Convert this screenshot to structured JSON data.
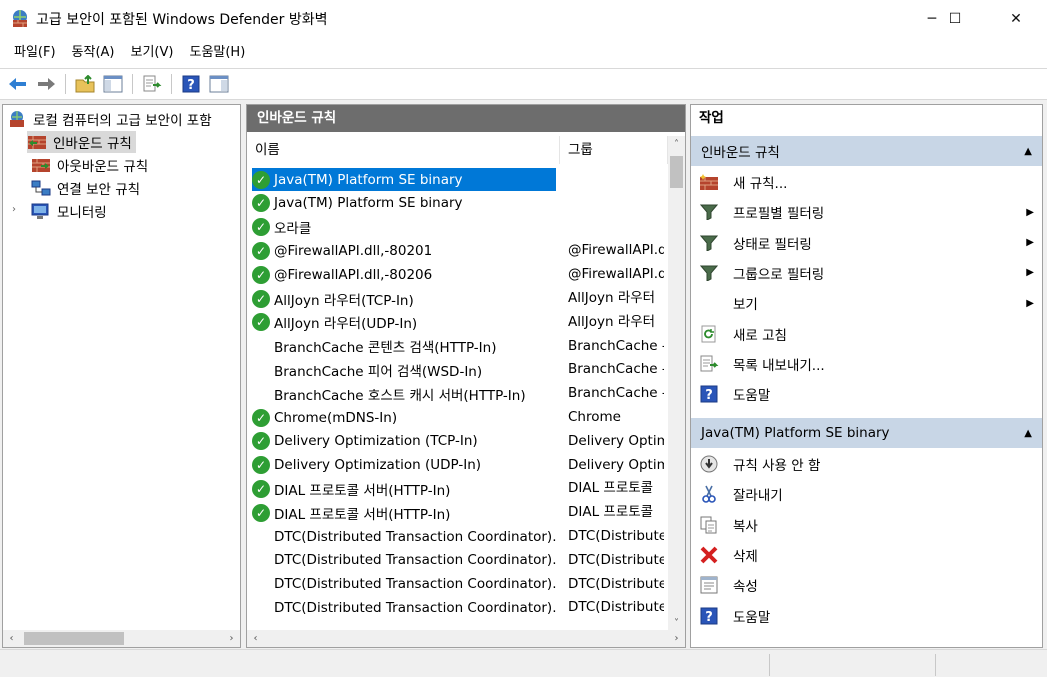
{
  "window": {
    "title": "고급 보안이 포함된 Windows Defender 방화벽",
    "minimize": "─",
    "maximize": "☐",
    "close": "✕"
  },
  "menu": [
    "파일(F)",
    "동작(A)",
    "보기(V)",
    "도움말(H)"
  ],
  "toolbar": {
    "icons": [
      "back-icon",
      "forward-icon",
      "up-folder-icon",
      "show-hide-console-tree-icon",
      "export-icon",
      "help-icon",
      "show-hide-action-pane-icon"
    ]
  },
  "tree": {
    "root": "로컬 컴퓨터의 고급 보안이 포함",
    "items": [
      {
        "label": "인바운드 규칙",
        "selected": true
      },
      {
        "label": "아웃바운드 규칙",
        "selected": false
      },
      {
        "label": "연결 보안 규칙",
        "selected": false
      },
      {
        "label": "모니터링",
        "selected": false
      }
    ]
  },
  "middle": {
    "header": "인바운드 규칙",
    "columns": [
      "이름",
      "그룹"
    ],
    "rows": [
      {
        "name": "Java(TM) Platform SE binary",
        "group": "",
        "enabled": true,
        "selected": true
      },
      {
        "name": "Java(TM) Platform SE binary",
        "group": "",
        "enabled": true,
        "selected": false
      },
      {
        "name": "오라클",
        "group": "",
        "enabled": true,
        "selected": false
      },
      {
        "name": "@FirewallAPI.dll,-80201",
        "group": "@FirewallAPI.d",
        "enabled": true,
        "selected": false
      },
      {
        "name": "@FirewallAPI.dll,-80206",
        "group": "@FirewallAPI.d",
        "enabled": true,
        "selected": false
      },
      {
        "name": "AllJoyn 라우터(TCP-In)",
        "group": "AllJoyn 라우터",
        "enabled": true,
        "selected": false
      },
      {
        "name": "AllJoyn 라우터(UDP-In)",
        "group": "AllJoyn 라우터",
        "enabled": true,
        "selected": false
      },
      {
        "name": "BranchCache 콘텐츠 검색(HTTP-In)",
        "group": "BranchCache -",
        "enabled": false,
        "selected": false
      },
      {
        "name": "BranchCache 피어 검색(WSD-In)",
        "group": "BranchCache -",
        "enabled": false,
        "selected": false
      },
      {
        "name": "BranchCache 호스트 캐시 서버(HTTP-In)",
        "group": "BranchCache -",
        "enabled": false,
        "selected": false
      },
      {
        "name": "Chrome(mDNS-In)",
        "group": "Chrome",
        "enabled": true,
        "selected": false
      },
      {
        "name": "Delivery Optimization (TCP-In)",
        "group": "Delivery Optim",
        "enabled": true,
        "selected": false
      },
      {
        "name": "Delivery Optimization (UDP-In)",
        "group": "Delivery Optim",
        "enabled": true,
        "selected": false
      },
      {
        "name": "DIAL 프로토콜 서버(HTTP-In)",
        "group": "DIAL 프로토콜",
        "enabled": true,
        "selected": false
      },
      {
        "name": "DIAL 프로토콜 서버(HTTP-In)",
        "group": "DIAL 프로토콜",
        "enabled": true,
        "selected": false
      },
      {
        "name": "DTC(Distributed Transaction Coordinator)...",
        "group": "DTC(Distribute",
        "enabled": false,
        "selected": false
      },
      {
        "name": "DTC(Distributed Transaction Coordinator)...",
        "group": "DTC(Distribute",
        "enabled": false,
        "selected": false
      },
      {
        "name": "DTC(Distributed Transaction Coordinator)...",
        "group": "DTC(Distribute",
        "enabled": false,
        "selected": false
      },
      {
        "name": "DTC(Distributed Transaction Coordinator)...",
        "group": "DTC(Distribute",
        "enabled": false,
        "selected": false
      }
    ]
  },
  "actions": {
    "title": "작업",
    "section1": {
      "header": "인바운드 규칙",
      "items": [
        {
          "label": "새 규칙...",
          "icon": "new-rule-icon",
          "submenu": false
        },
        {
          "label": "프로필별 필터링",
          "icon": "filter-icon",
          "submenu": true
        },
        {
          "label": "상태로 필터링",
          "icon": "filter-icon",
          "submenu": true
        },
        {
          "label": "그룹으로 필터링",
          "icon": "filter-icon",
          "submenu": true
        },
        {
          "label": "보기",
          "icon": "",
          "submenu": true
        },
        {
          "label": "새로 고침",
          "icon": "refresh-icon",
          "submenu": false
        },
        {
          "label": "목록 내보내기...",
          "icon": "export-list-icon",
          "submenu": false
        },
        {
          "label": "도움말",
          "icon": "help-icon",
          "submenu": false
        }
      ]
    },
    "section2": {
      "header": "Java(TM) Platform SE binary",
      "items": [
        {
          "label": "규칙 사용 안 함",
          "icon": "disable-rule-icon"
        },
        {
          "label": "잘라내기",
          "icon": "cut-icon"
        },
        {
          "label": "복사",
          "icon": "copy-icon"
        },
        {
          "label": "삭제",
          "icon": "delete-icon"
        },
        {
          "label": "속성",
          "icon": "properties-icon"
        },
        {
          "label": "도움말",
          "icon": "help-icon"
        }
      ]
    }
  },
  "colors": {
    "selection": "#0078d7",
    "enabled_check": "#2e9e34",
    "section_header": "#c8d6e6",
    "pane_header": "#6d6d6d"
  }
}
